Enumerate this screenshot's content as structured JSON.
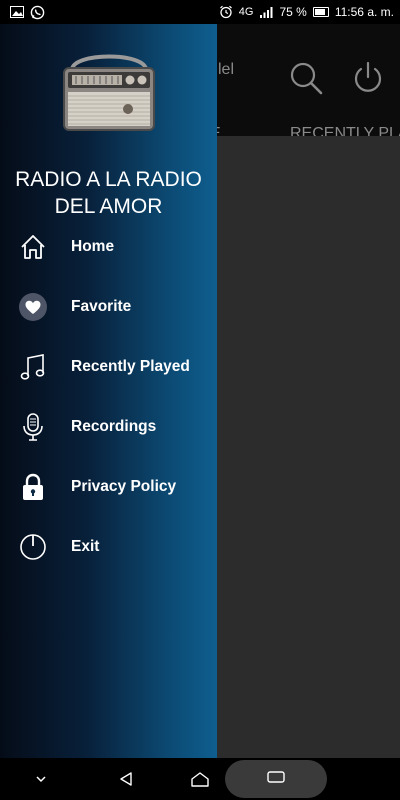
{
  "status_bar": {
    "signal_icon": "4g-signal-icon",
    "network_label": "4G",
    "battery_percent": "75 %",
    "time": "11:56 a. m.",
    "left_icons": [
      "gallery-icon",
      "whatsapp-icon"
    ],
    "right_icons": [
      "alarm-icon",
      "battery-icon"
    ]
  },
  "app": {
    "title_fragment": "lel",
    "tab_left_fragment": "E",
    "tab_recent": "RECENTLY PLA",
    "icons": [
      "search-icon",
      "power-icon"
    ]
  },
  "drawer": {
    "header_image": "vintage-radio-image",
    "station_name_line1": "RADIO A LA RADIO",
    "station_name_line2": "DEL AMOR",
    "menu": [
      {
        "label": "Home",
        "icon": "home-icon"
      },
      {
        "label": "Favorite",
        "icon": "heart-icon"
      },
      {
        "label": "Recently Played",
        "icon": "music-note-icon"
      },
      {
        "label": "Recordings",
        "icon": "microphone-icon"
      },
      {
        "label": "Privacy Policy",
        "icon": "lock-icon"
      },
      {
        "label": "Exit",
        "icon": "power-icon"
      }
    ]
  },
  "nav_bar": {
    "buttons": [
      "hide-keyboard-icon",
      "back-icon",
      "home-icon",
      "recents-icon"
    ]
  },
  "colors": {
    "drawer_gradient_start": "#050c18",
    "drawer_gradient_end": "#0e5e8f",
    "content_background": "#2c2c2c",
    "header_background": "#0c0c0c"
  }
}
